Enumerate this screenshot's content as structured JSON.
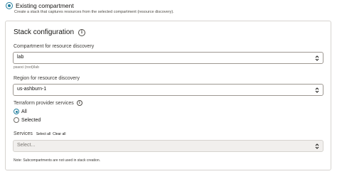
{
  "existing": {
    "label": "Existing compartment",
    "description": "Create a stack that captures resources from the selected compartment (resource discovery)."
  },
  "stack": {
    "title": "Stack configuration",
    "compartment_label": "Compartment for resource discovery",
    "compartment_value": "lab",
    "compartment_path": "psaoci (root)/lab",
    "region_label": "Region for resource discovery",
    "region_value": "us-ashburn-1",
    "terraform_label": "Terraform provider services",
    "options": [
      "All",
      "Selected"
    ],
    "services_label": "Services",
    "select_all": "Select all",
    "clear_all": "Clear all",
    "services_placeholder": "Select...",
    "note": "Note: Subcompartments are not used in stack creation."
  }
}
